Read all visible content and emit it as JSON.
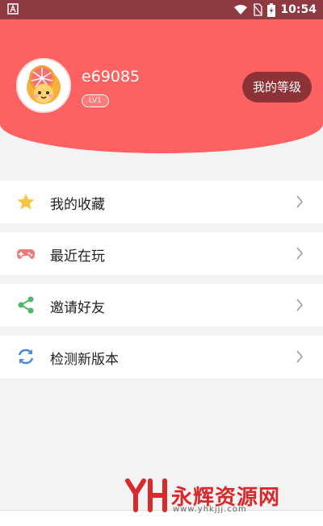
{
  "status_bar": {
    "time": "10:54",
    "icons": [
      "a-icon",
      "wifi-icon",
      "sim-off-icon",
      "battery-icon"
    ]
  },
  "profile": {
    "username": "e69085",
    "level_badge": "LV1",
    "my_level_button": "我的等级"
  },
  "menu": [
    {
      "label": "我的收藏",
      "icon": "star-icon",
      "icon_color": "#f7c542"
    },
    {
      "label": "最近在玩",
      "icon": "gamepad-icon",
      "icon_color": "#f27a7a"
    },
    {
      "label": "邀请好友",
      "icon": "share-icon",
      "icon_color": "#4cb86a"
    },
    {
      "label": "检测新版本",
      "icon": "refresh-icon",
      "icon_color": "#4a8de0"
    }
  ],
  "watermark": {
    "logo_text": "YH",
    "title": "永辉资源网",
    "subtitle": "www.yhkjjj.com"
  },
  "colors": {
    "header": "#fd6262",
    "status_bar": "#8e3a40",
    "level_button": "#8d3236"
  }
}
